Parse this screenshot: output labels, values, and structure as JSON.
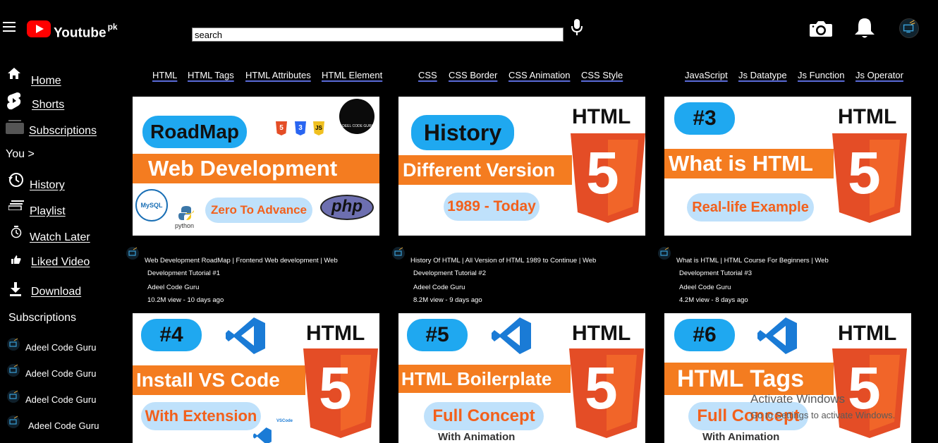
{
  "header": {
    "brand": "Youtube",
    "brand_sup": "pk",
    "search_value": "search"
  },
  "sidebar": {
    "items": [
      {
        "label": "Home",
        "icon": "home-icon"
      },
      {
        "label": "Shorts",
        "icon": "shorts-icon"
      },
      {
        "label": "Subscriptions",
        "icon": "subscriptions-icon"
      }
    ],
    "you_label": "You >",
    "you_items": [
      {
        "label": "History",
        "icon": "history-icon"
      },
      {
        "label": "Playlist",
        "icon": "playlist-icon"
      },
      {
        "label": "Watch Later",
        "icon": "watch-later-icon"
      },
      {
        "label": "Liked Video",
        "icon": "like-icon"
      },
      {
        "label": "Download",
        "icon": "download-icon"
      }
    ],
    "subscriptions_heading": "Subscriptions",
    "subscriptions": [
      "Adeel Code Guru",
      "Adeel Code Guru",
      "Adeel Code Guru",
      "Adeel Code Guru"
    ]
  },
  "chips": {
    "html": [
      "HTML",
      "HTML Tags",
      "HTML Attributes",
      "HTML Element"
    ],
    "css": [
      "CSS",
      "CSS Border",
      "CSS Animation",
      "CSS Style"
    ],
    "js": [
      "JavaScript",
      "Js Datatype",
      "Js Function",
      "Js Operator"
    ]
  },
  "videos": [
    {
      "title1": "Web Development RoadMap | Frontend Web development | Web",
      "title2": "Development Tutorial #1",
      "channel": "Adeel Code Guru",
      "stats": "10.2M view - 10 days ago",
      "thumb": {
        "pill": "RoadMap",
        "band": "Web Development",
        "sub": "Zero To Advance",
        "badges": [
          "5",
          "3",
          "JS"
        ],
        "logo_text": "ADEEL CODE GURU",
        "extra1": "MySQL",
        "extra2": "python",
        "extra3": "php"
      }
    },
    {
      "title1": "History Of HTML | All Version of HTML 1989 to Continue | Web",
      "title2": "Development Tutorial #2",
      "channel": "Adeel Code Guru",
      "stats": "8.2M view - 9 days ago",
      "thumb": {
        "pill": "History",
        "band": "Different Version",
        "sub": "1989 - Today",
        "html": "HTML",
        "five": "5"
      }
    },
    {
      "title1": "What is HTML | HTML Course For Beginners | Web",
      "title2": "Development Tutorial #3",
      "channel": "Adeel Code Guru",
      "stats": "4.2M view - 8 days ago",
      "thumb": {
        "pill": "#3",
        "band": "What is HTML",
        "sub": "Real-life Example",
        "html": "HTML",
        "five": "5"
      }
    },
    {
      "thumb": {
        "pill": "#4",
        "band": "Install VS Code",
        "sub": "With Extension",
        "html": "HTML",
        "five": "5",
        "vs_label": "VSCode"
      }
    },
    {
      "thumb": {
        "pill": "#5",
        "band": "HTML Boilerplate",
        "sub": "Full Concept",
        "sub2": "With Animation",
        "html": "HTML",
        "five": "5"
      }
    },
    {
      "thumb": {
        "pill": "#6",
        "band": "HTML Tags",
        "sub": "Full Concept",
        "sub2": "With Animation",
        "html": "HTML",
        "five": "5"
      }
    }
  ],
  "watermark": {
    "line1": "Activate Windows",
    "line2": "Go to Settings to activate Windows."
  },
  "colors": {
    "background": "#000000",
    "brand_red": "#ff0000",
    "pill_blue": "#1fa8f0",
    "band_orange": "#f47c20",
    "html5_orange": "#e44d26",
    "chip_underline": "#5a6bd8"
  }
}
